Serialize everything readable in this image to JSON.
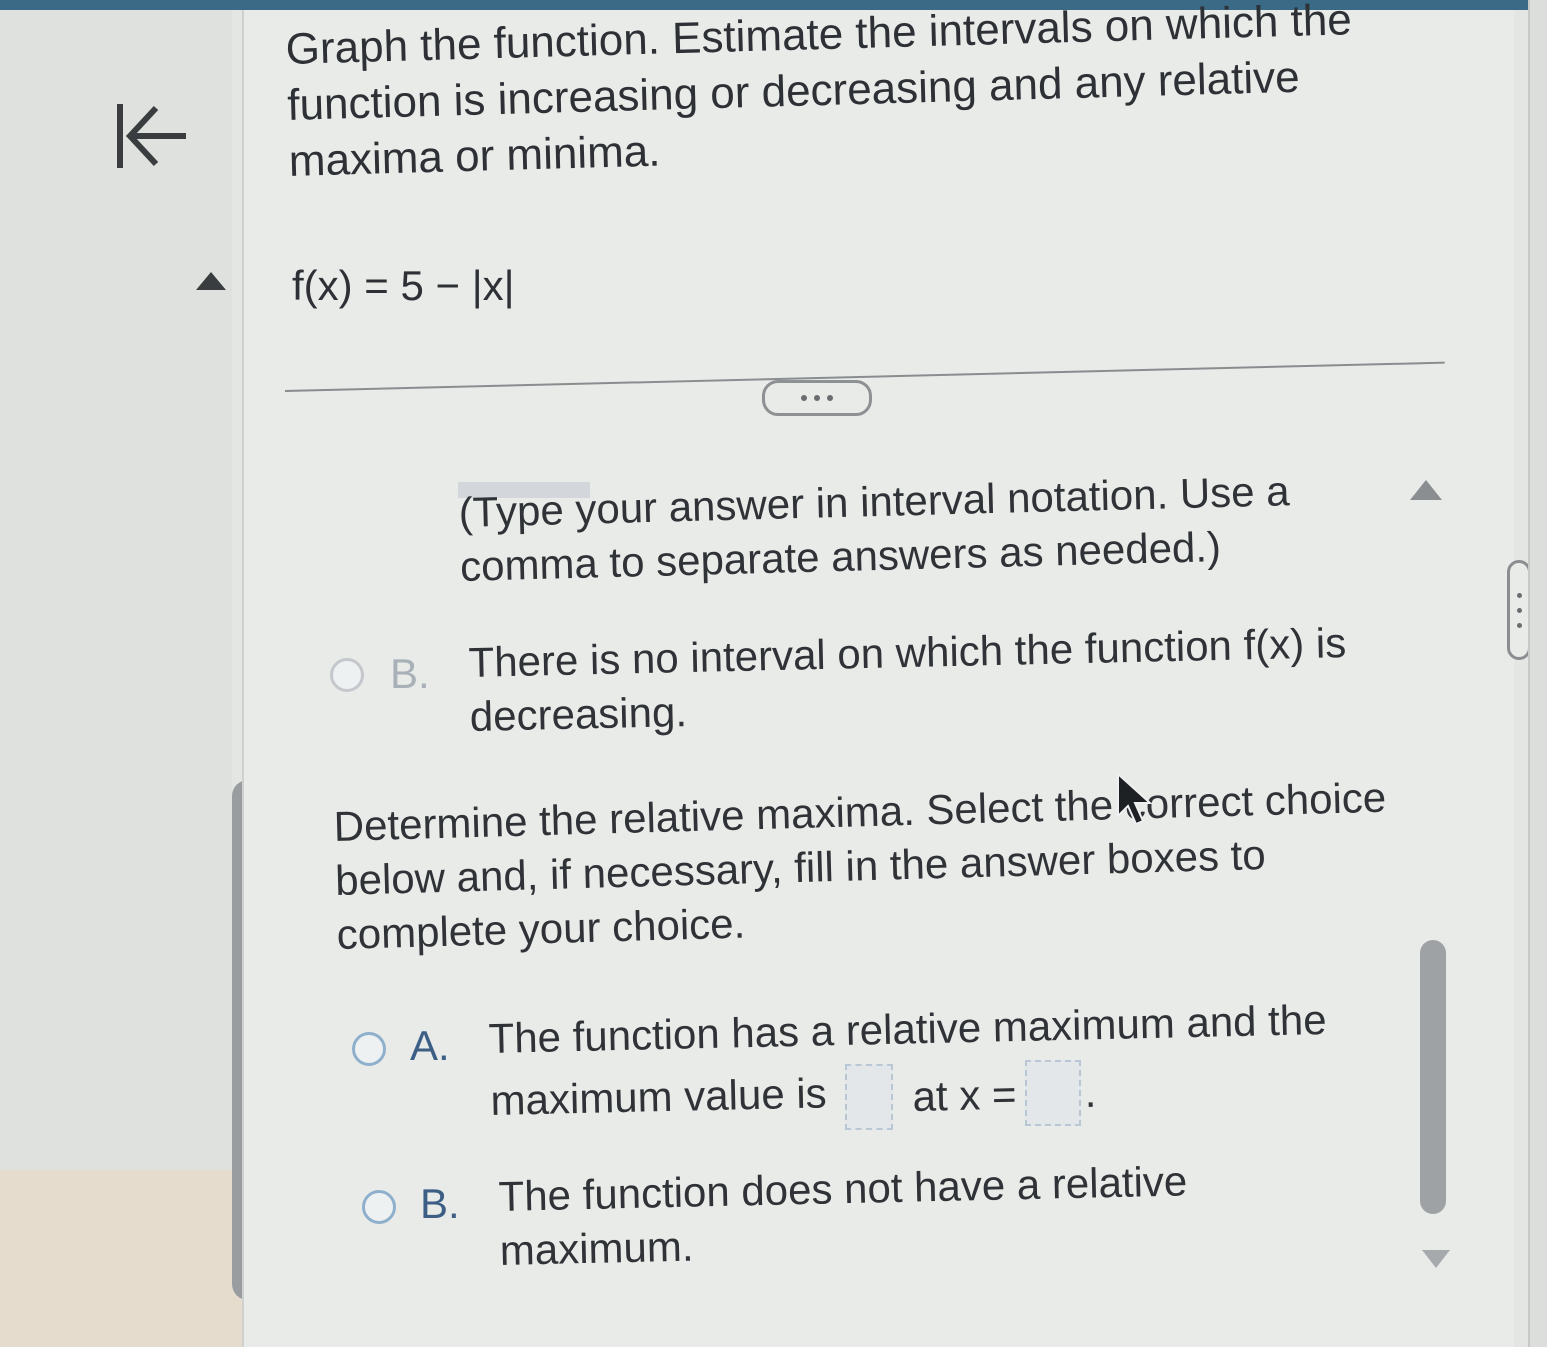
{
  "question": {
    "text": "Graph the function. Estimate the intervals on which the function is increasing or decreasing and any relative maxima or minima.",
    "formula": "f(x) = 5 − |x|"
  },
  "more_button_label": "",
  "part1": {
    "hint": "(Type your answer in interval notation. Use a comma to separate answers as needed.)",
    "option_b": {
      "letter": "B.",
      "text": "There is no interval on which the function f(x) is decreasing."
    }
  },
  "part2": {
    "prompt": "Determine the relative maxima. Select the correct choice below and, if necessary, fill in the answer boxes to complete your choice.",
    "option_a": {
      "letter": "A.",
      "line1": "The function has a relative maximum and the",
      "line2_prefix": "maximum value is",
      "line2_mid": "at x =",
      "line2_suffix": ".",
      "max_value": "",
      "at_x": ""
    },
    "option_b": {
      "letter": "B.",
      "text": "The function does not have a relative maximum."
    }
  },
  "icons": {
    "back": "collapse-left-icon",
    "scroll_up": "triangle-up-icon",
    "scroll_down": "triangle-down-icon",
    "cursor": "mouse-pointer-icon"
  },
  "colors": {
    "accent": "#3d5f86",
    "radio_border": "#8fb0cc",
    "topbar": "#3a6a86"
  }
}
